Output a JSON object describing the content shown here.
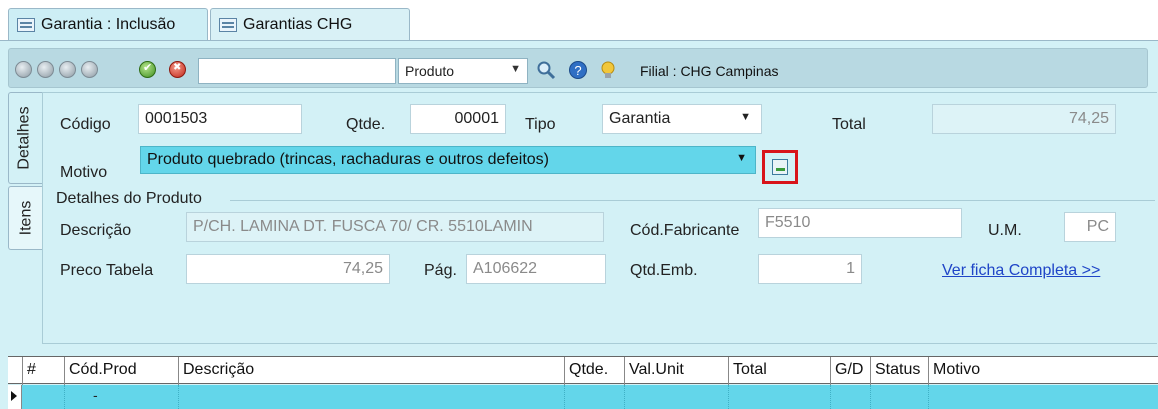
{
  "tabs": [
    {
      "label": "Garantia : Inclusão"
    },
    {
      "label": "Garantias CHG"
    }
  ],
  "toolbar": {
    "search_value": "",
    "search_type": "Produto",
    "filial": "Filial : CHG Campinas"
  },
  "side_tabs": {
    "detalhes": "Detalhes",
    "itens": "Itens"
  },
  "form": {
    "codigo_label": "Código",
    "codigo_value": "0001503",
    "qtde_label": "Qtde.",
    "qtde_value": "00001",
    "tipo_label": "Tipo",
    "tipo_value": "Garantia",
    "total_label": "Total",
    "total_value": "74,25",
    "motivo_label": "Motivo",
    "motivo_value": "Produto quebrado (trincas, rachaduras e outros defeitos)"
  },
  "produto": {
    "section_label": "Detalhes do Produto",
    "descricao_label": "Descrição",
    "descricao_value": "P/CH. LAMINA DT. FUSCA 70/ CR. 5510LAMIN",
    "cod_fabricante_label": "Cód.Fabricante",
    "cod_fabricante_value": "F5510",
    "um_label": "U.M.",
    "um_value": "PC",
    "preco_label": "Preco Tabela",
    "preco_value": "74,25",
    "pag_label": "Pág.",
    "pag_value": "A106622",
    "qtd_emb_label": "Qtd.Emb.",
    "qtd_emb_value": "1",
    "ficha_link": "Ver ficha Completa >>"
  },
  "grid": {
    "columns": [
      "#",
      "Cód.Prod",
      "Descrição",
      "Qtde.",
      "Val.Unit",
      "Total",
      "G/D",
      "Status",
      "Motivo"
    ],
    "rows": [
      {
        "cod": "-"
      }
    ]
  },
  "colors": {
    "accent": "#63d6ea",
    "panel": "#d3f1f6",
    "highlight": "#d8141a",
    "link": "#1f45c7"
  }
}
